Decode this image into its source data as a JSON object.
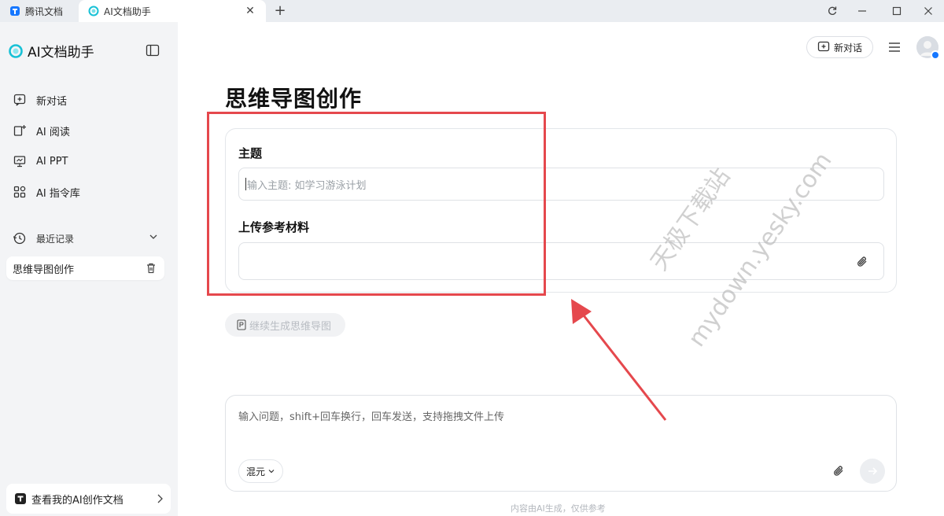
{
  "browser": {
    "tabs": [
      {
        "label": "腾讯文档"
      },
      {
        "label": "AI文档助手"
      }
    ],
    "close_glyph": "✕",
    "new_tab_glyph": "+"
  },
  "sidebar": {
    "brand": "AI文档助手",
    "nav": [
      {
        "label": "新对话",
        "icon": "new-chat-icon"
      },
      {
        "label": "AI 阅读",
        "icon": "read-icon"
      },
      {
        "label": "AI PPT",
        "icon": "ppt-icon"
      },
      {
        "label": "AI 指令库",
        "icon": "prompt-library-icon"
      }
    ],
    "recent_label": "最近记录",
    "history": [
      {
        "label": "思维导图创作"
      }
    ],
    "my_docs_label": "查看我的AI创作文档"
  },
  "header": {
    "new_chat_label": "新对话"
  },
  "main": {
    "title": "思维导图创作",
    "topic_label": "主题",
    "topic_placeholder": "输入主题: 如学习游泳计划",
    "upload_label": "上传参考材料",
    "generate_label": "继续生成思维导图",
    "chat_placeholder": "输入问题，shift+回车换行，回车发送，支持拖拽文件上传",
    "model_label": "混元",
    "footer_note": "内容由AI生成，仅供参考"
  },
  "watermark": {
    "line1": "天极下载站",
    "line2": "mydown.yesky.com"
  },
  "colors": {
    "annotation_red": "#e5484d",
    "brand_cyan": "#17c1d6",
    "brand_blue": "#1677ff"
  }
}
